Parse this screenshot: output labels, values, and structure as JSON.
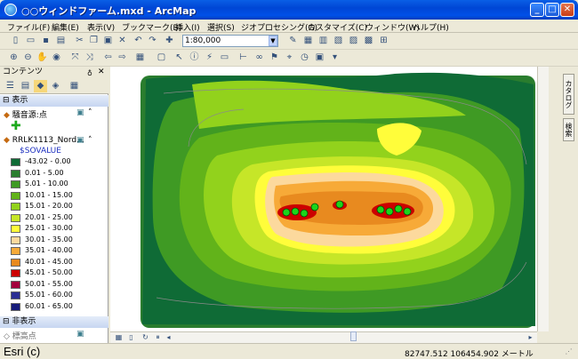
{
  "window": {
    "title": "○○ウィンドファーム.mxd - ArcMap",
    "min": "_",
    "max": "□",
    "close": "✕"
  },
  "menu": [
    "ファイル(F)",
    "編集(E)",
    "表示(V)",
    "ブックマーク(B)",
    "挿入(I)",
    "選択(S)",
    "ジオプロセシング(G)",
    "カスタマイズ(C)",
    "ウィンドウ(W)",
    "ヘルプ(H)"
  ],
  "toolbar": {
    "scale": "1:80,000"
  },
  "toc": {
    "title": "コンテンツ",
    "pin": "♁",
    "close": "✕",
    "sections": {
      "visible": "表示",
      "hidden": "非表示"
    },
    "layers": {
      "points": "騒音源:点",
      "raster": "RRLK1113_Nord...",
      "field": "$SOVALUE",
      "elevation": "標高点"
    },
    "legend": [
      {
        "label": "-43.02 - 0.00",
        "color": "#0f6b36"
      },
      {
        "label": "0.01 - 5.00",
        "color": "#2a7d2e"
      },
      {
        "label": "5.01 - 10.00",
        "color": "#3f9a24"
      },
      {
        "label": "10.01 - 15.00",
        "color": "#62b31a"
      },
      {
        "label": "15.01 - 20.00",
        "color": "#92d21c"
      },
      {
        "label": "20.01 - 25.00",
        "color": "#c6e628"
      },
      {
        "label": "25.01 - 30.00",
        "color": "#fffd3a"
      },
      {
        "label": "30.01 - 35.00",
        "color": "#fcd99d"
      },
      {
        "label": "35.01 - 40.00",
        "color": "#f7aa38"
      },
      {
        "label": "40.01 - 45.00",
        "color": "#e88a1f"
      },
      {
        "label": "45.01 - 50.00",
        "color": "#cc0000"
      },
      {
        "label": "50.01 - 55.00",
        "color": "#a3003c"
      },
      {
        "label": "55.01 - 60.00",
        "color": "#2b2e93"
      },
      {
        "label": "60.01 - 65.00",
        "color": "#161b7a"
      }
    ]
  },
  "sidebar": {
    "catalog": "カタログ",
    "search": "検索"
  },
  "status": {
    "watermark": "Esri (c)",
    "coordinates": "82747.512  106454.902 メートル"
  }
}
